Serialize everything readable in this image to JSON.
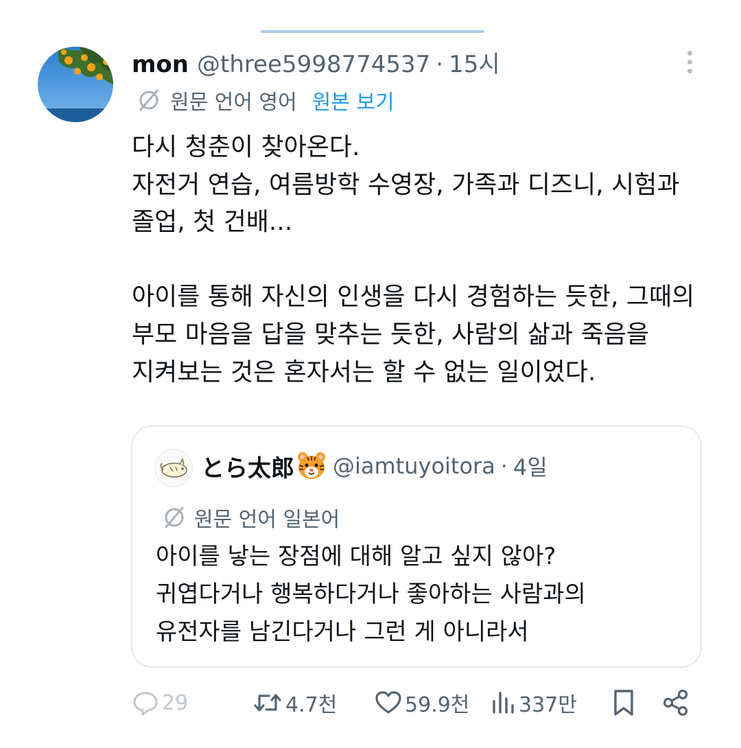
{
  "post": {
    "author_name": "mon",
    "author_handle": "@three5998774537",
    "separator": "·",
    "time": "15시",
    "translation": {
      "original_language": "원문 언어 영어",
      "show_original": "원본 보기"
    },
    "body_lines": [
      "다시 청춘이 찾아온다.",
      "자전거 연습, 여름방학 수영장, 가족과 디즈니, 시험과",
      "졸업, 첫 건배...",
      "",
      "아이를 통해 자신의 인생을 다시 경험하는 듯한, 그때의",
      "부모 마음을 답을 맞추는 듯한, 사람의 삶과 죽음을",
      "지켜보는 것은 혼자서는 할 수 없는 일이었다."
    ]
  },
  "quote": {
    "author_name": "とら太郎",
    "badge": "tiger-face-emoji",
    "author_handle": "@iamtuyoitora",
    "separator": "·",
    "time": "4일",
    "original_language": "원문 언어 일본어",
    "body_lines": [
      "아이를 낳는 장점에 대해 알고 싶지 않아?",
      "귀엽다거나 행복하다거나 좋아하는 사람과의",
      "유전자를 남긴다거나 그런 게 아니라서"
    ]
  },
  "actions": {
    "replies": "29",
    "reposts": "4.7천",
    "likes": "59.9천",
    "views": "337만"
  },
  "colors": {
    "text_primary": "#0f1419",
    "text_secondary": "#536471",
    "link": "#1d9bf0",
    "reply_muted": "#c0c7cd",
    "border": "#e6e9eb"
  },
  "icons": [
    "translate-icon",
    "more-icon",
    "reply-icon",
    "repost-icon",
    "like-icon",
    "views-icon",
    "bookmark-icon",
    "share-icon"
  ]
}
